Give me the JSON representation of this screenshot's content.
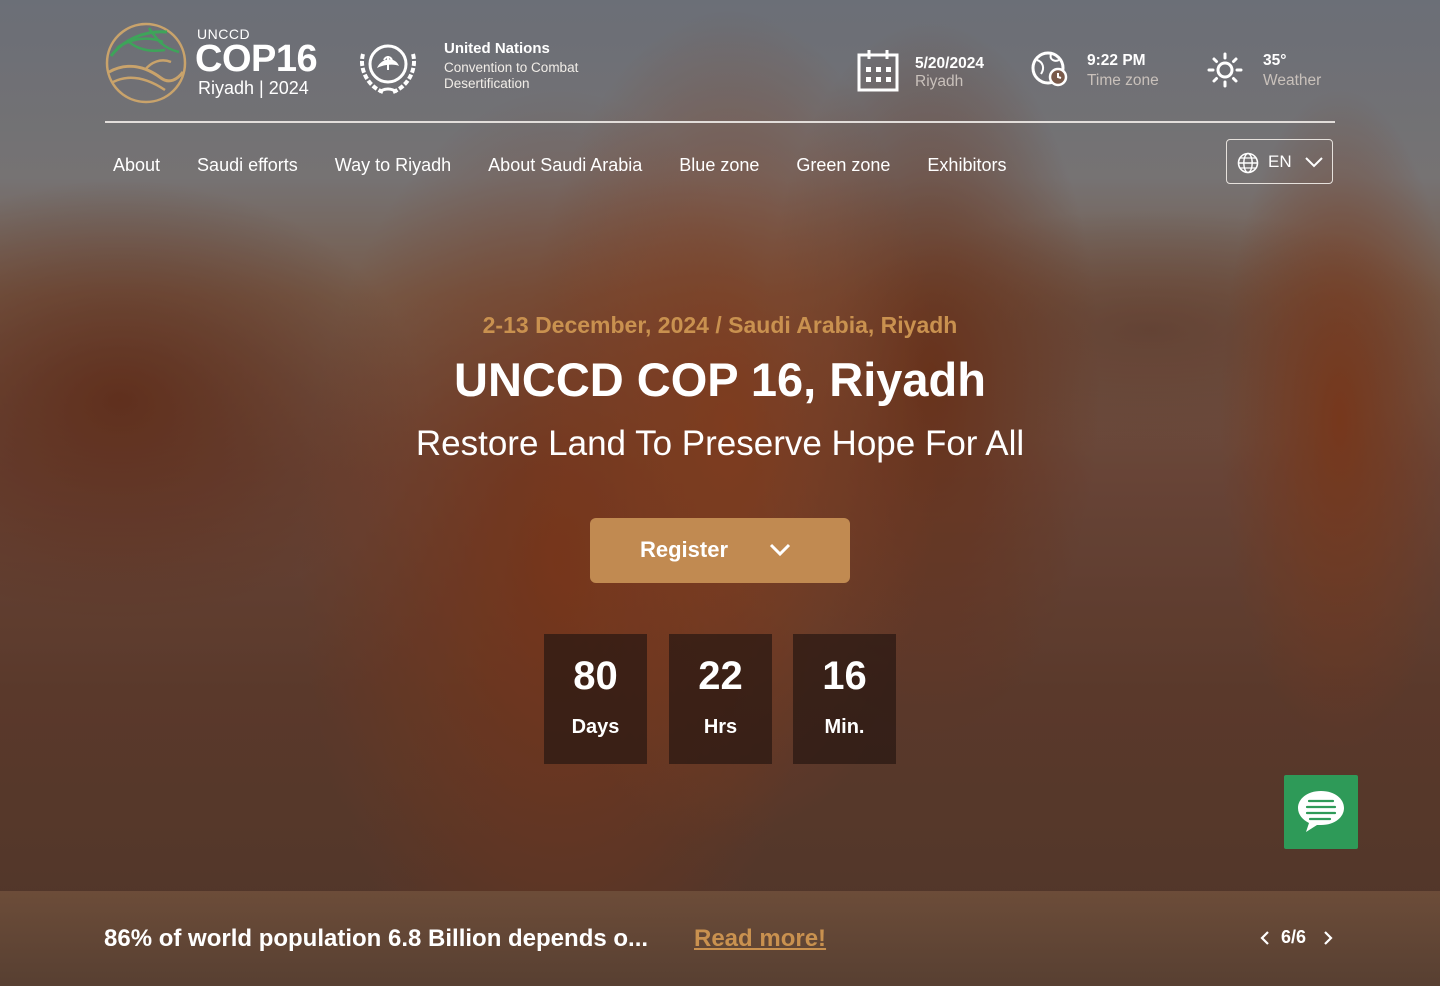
{
  "header": {
    "cop_logo": {
      "org": "UNCCD",
      "name": "COP16",
      "city": "Riyadh",
      "year": "2024",
      "city_year": "Riyadh | 2024"
    },
    "un_logo": {
      "title": "United Nations",
      "line1": "Convention to Combat",
      "line2": "Desertification"
    },
    "date": {
      "value": "5/20/2024",
      "label": "Riyadh",
      "icon": "calendar-icon"
    },
    "time": {
      "value": "9:22 PM",
      "label": "Time zone",
      "icon": "clock-globe-icon"
    },
    "weather": {
      "value": "35°",
      "label": "Weather",
      "icon": "sun-icon"
    }
  },
  "nav": {
    "items": [
      "About",
      "Saudi efforts",
      "Way to Riyadh",
      "About Saudi Arabia",
      "Blue zone",
      "Green zone",
      "Exhibitors"
    ],
    "language": "EN"
  },
  "hero": {
    "date_location": "2-13 December, 2024 / Saudi Arabia, Riyadh",
    "title": "UNCCD COP 16, Riyadh",
    "subtitle": "Restore Land To Preserve Hope For All",
    "register_label": "Register",
    "countdown": [
      {
        "value": "80",
        "unit": "Days"
      },
      {
        "value": "22",
        "unit": "Hrs"
      },
      {
        "value": "16",
        "unit": "Min."
      }
    ]
  },
  "ticker": {
    "text": "86% of world population 6.8 Billion depends o...",
    "read_more": "Read more!",
    "pager": "6/6"
  },
  "colors": {
    "accent": "#c18a51",
    "accent_text": "#c9914f",
    "chat": "#2e9a58"
  }
}
